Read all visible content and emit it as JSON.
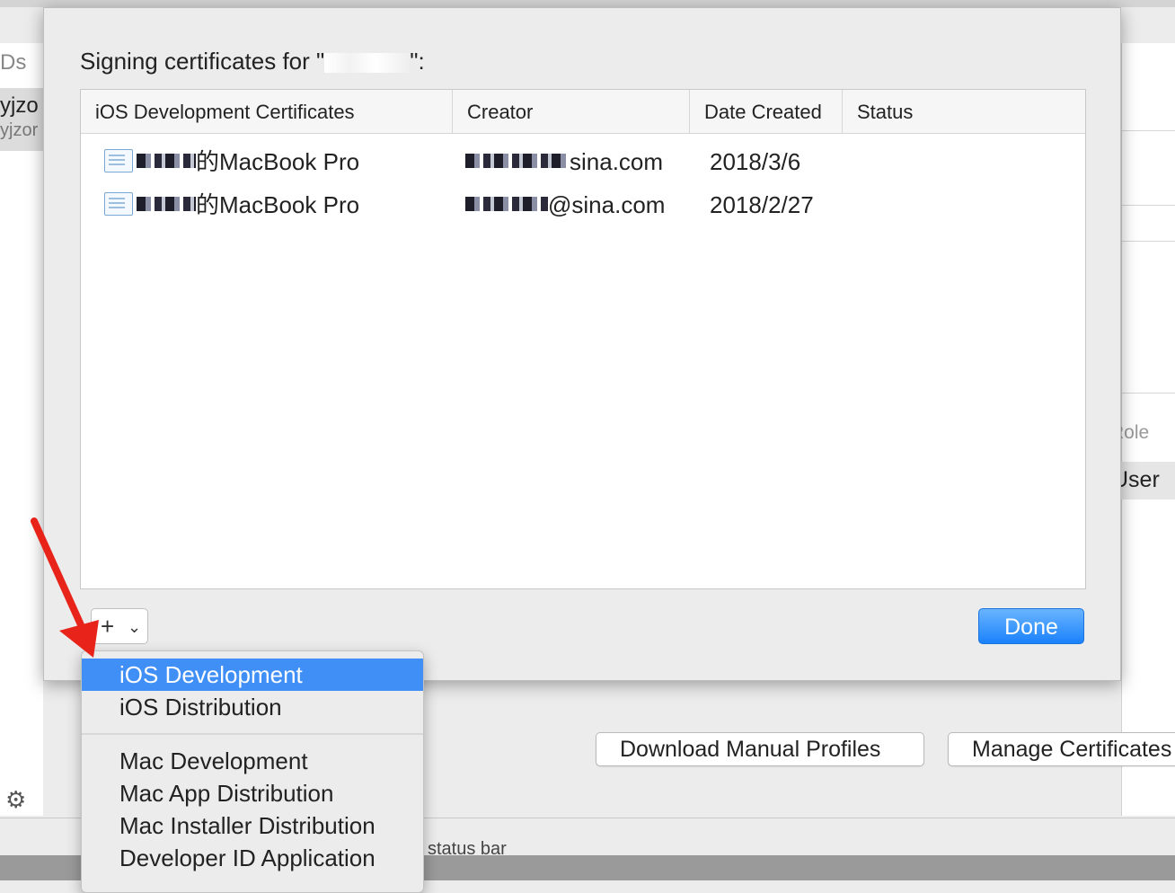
{
  "background": {
    "left_labels": [
      "Ds",
      "yjzo",
      "yjzor"
    ],
    "right_labels": [
      "Role",
      "User"
    ],
    "status_fragment": "status bar",
    "buttons": {
      "download": "Download Manual Profiles",
      "manage": "Manage Certificates"
    }
  },
  "sheet": {
    "title_prefix": "Signing certificates for \"",
    "title_suffix": "\":",
    "columns": [
      "iOS Development Certificates",
      "Creator",
      "Date Created",
      "Status"
    ],
    "rows": [
      {
        "name_suffix": "的MacBook Pro",
        "creator_suffix": "sina.com",
        "date": "2018/3/6",
        "status": ""
      },
      {
        "name_suffix": "的MacBook Pro",
        "creator_suffix": "@sina.com",
        "date": "2018/2/27",
        "status": ""
      }
    ],
    "add_button": "+",
    "done_button": "Done"
  },
  "menu": {
    "items": [
      "iOS Development",
      "iOS Distribution",
      "Mac Development",
      "Mac App Distribution",
      "Mac Installer Distribution",
      "Developer ID Application"
    ],
    "selected": "iOS Development"
  },
  "colors": {
    "accent": "#1a82fb",
    "menu_selection": "#3f8ff7",
    "annotation_arrow": "#e8231a"
  },
  "icons": [
    "certificate-icon",
    "chevron-down-icon",
    "plus-icon",
    "gear-icon",
    "red-arrow-annotation"
  ]
}
